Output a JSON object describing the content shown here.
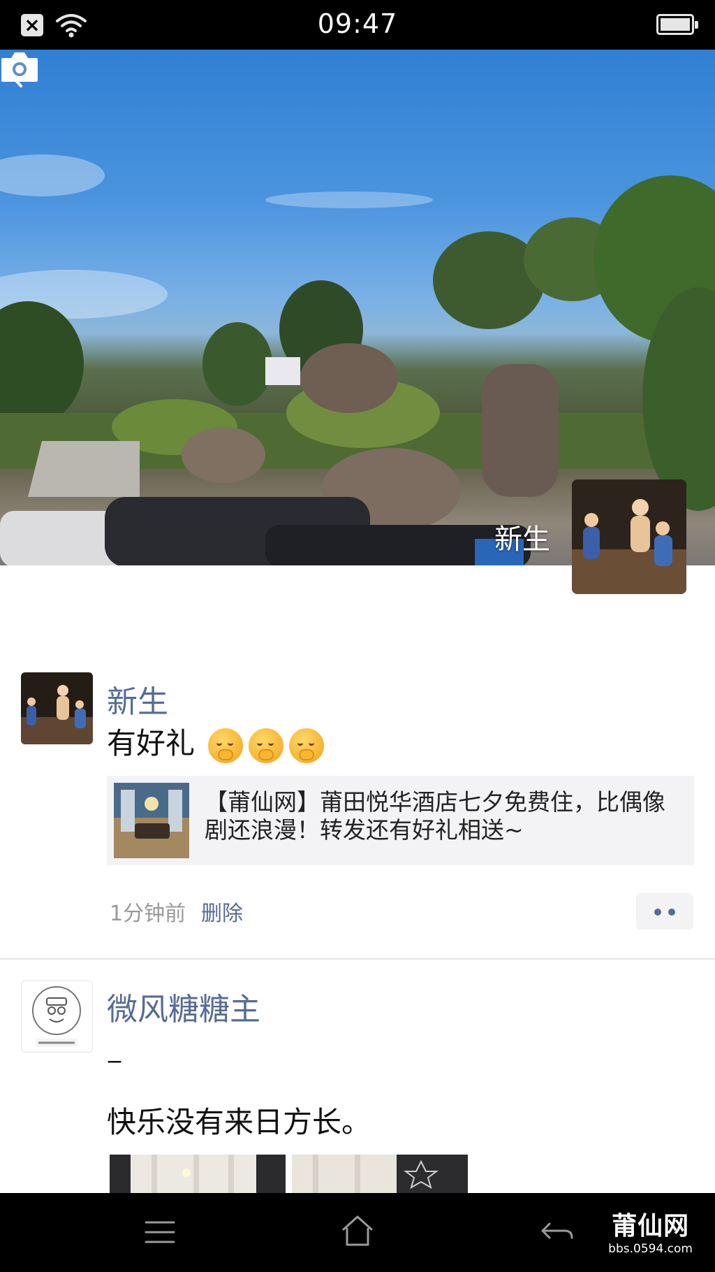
{
  "status_bar": {
    "time": "09:47"
  },
  "cover": {
    "profile_name": "新生"
  },
  "posts": [
    {
      "author": "新生",
      "text": "有好礼",
      "emojis": [
        "hugging-face",
        "hugging-face",
        "hugging-face"
      ],
      "link": {
        "title": "【莆仙网】莆田悦华酒店七夕免费住，比偶像剧还浪漫！转发还有好礼相送~"
      },
      "time": "1分钟前",
      "delete_label": "删除"
    },
    {
      "author": "微风糖糖主",
      "line1": "_",
      "text": "快乐没有来日方长。"
    }
  ],
  "watermark": {
    "logo": "莆仙网",
    "url": "bbs.0594.com"
  },
  "colors": {
    "link_blue": "#576b95",
    "card_bg": "#f3f3f5"
  }
}
